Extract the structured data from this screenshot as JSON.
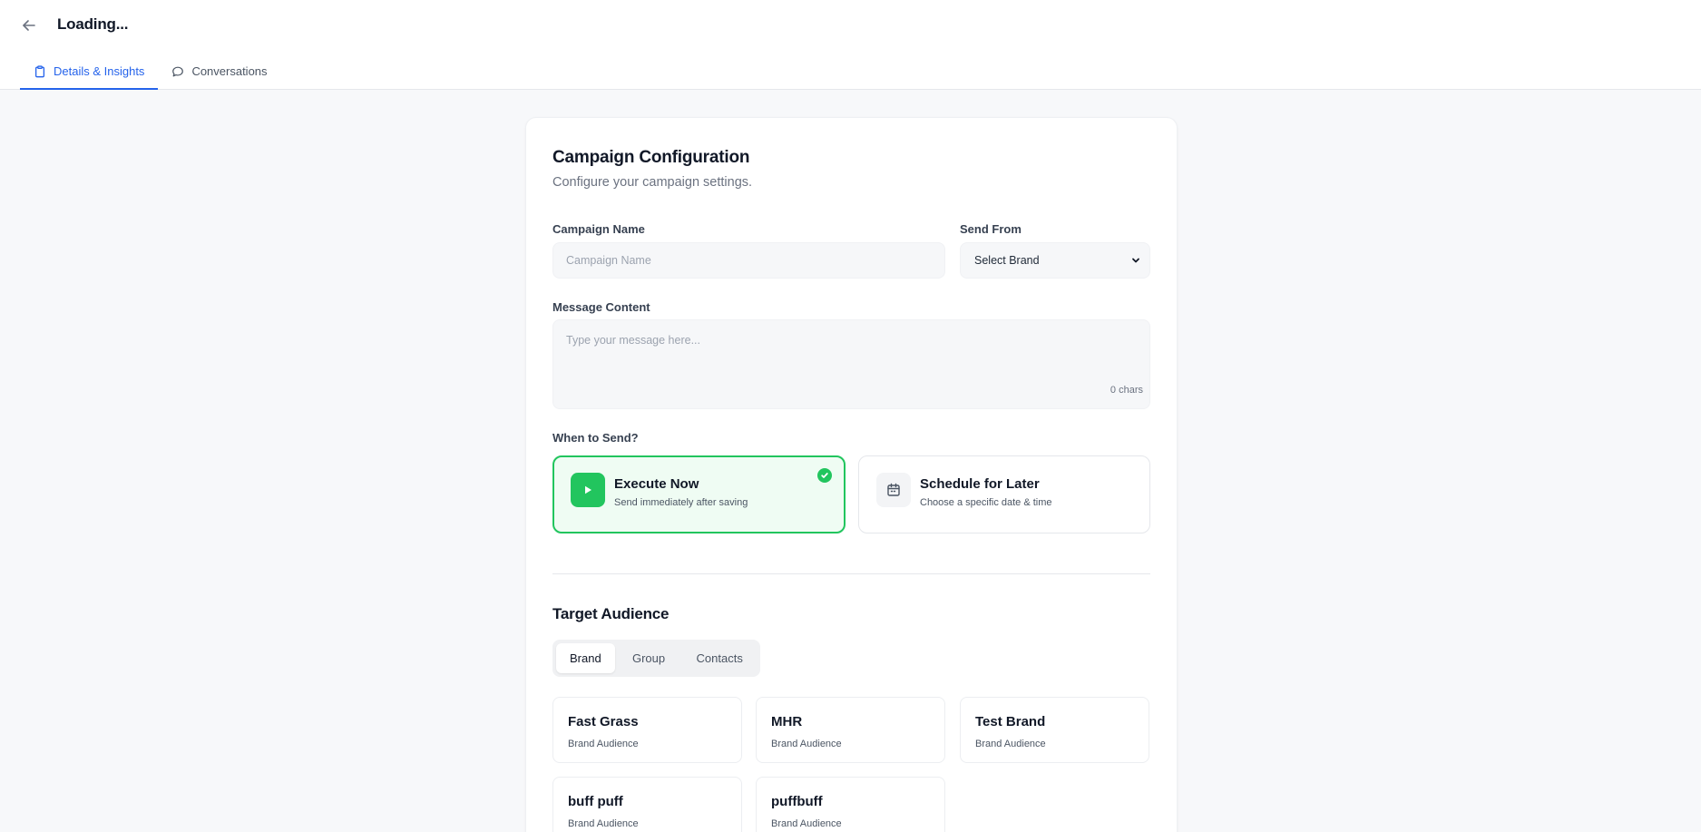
{
  "header": {
    "title": "Loading...",
    "tabs": [
      {
        "label": "Details & Insights",
        "icon": "clipboard-icon",
        "active": true
      },
      {
        "label": "Conversations",
        "icon": "chat-bubble-icon",
        "active": false
      }
    ]
  },
  "card": {
    "title": "Campaign Configuration",
    "subtitle": "Configure your campaign settings.",
    "campaign_name": {
      "label": "Campaign Name",
      "placeholder": "Campaign Name",
      "value": ""
    },
    "send_from": {
      "label": "Send From",
      "selected": "Select Brand"
    },
    "message": {
      "label": "Message Content",
      "placeholder": "Type your message here...",
      "value": "",
      "char_count": "0 chars"
    },
    "when_to_send": {
      "label": "When to Send?",
      "options": [
        {
          "title": "Execute Now",
          "description": "Send immediately after saving",
          "icon": "play-icon",
          "selected": true
        },
        {
          "title": "Schedule for Later",
          "description": "Choose a specific date & time",
          "icon": "calendar-icon",
          "selected": false
        }
      ]
    }
  },
  "audience": {
    "title": "Target Audience",
    "tabs": [
      {
        "label": "Brand",
        "active": true
      },
      {
        "label": "Group",
        "active": false
      },
      {
        "label": "Contacts",
        "active": false
      }
    ],
    "items": [
      {
        "name": "Fast Grass",
        "type": "Brand Audience"
      },
      {
        "name": "MHR",
        "type": "Brand Audience"
      },
      {
        "name": "Test Brand",
        "type": "Brand Audience"
      },
      {
        "name": "buff puff",
        "type": "Brand Audience"
      },
      {
        "name": "puffbuff",
        "type": "Brand Audience"
      }
    ]
  },
  "colors": {
    "accent": "#2563eb",
    "success": "#22c55e",
    "success_bg": "#effcf3",
    "page_bg": "#f7f8fa"
  }
}
